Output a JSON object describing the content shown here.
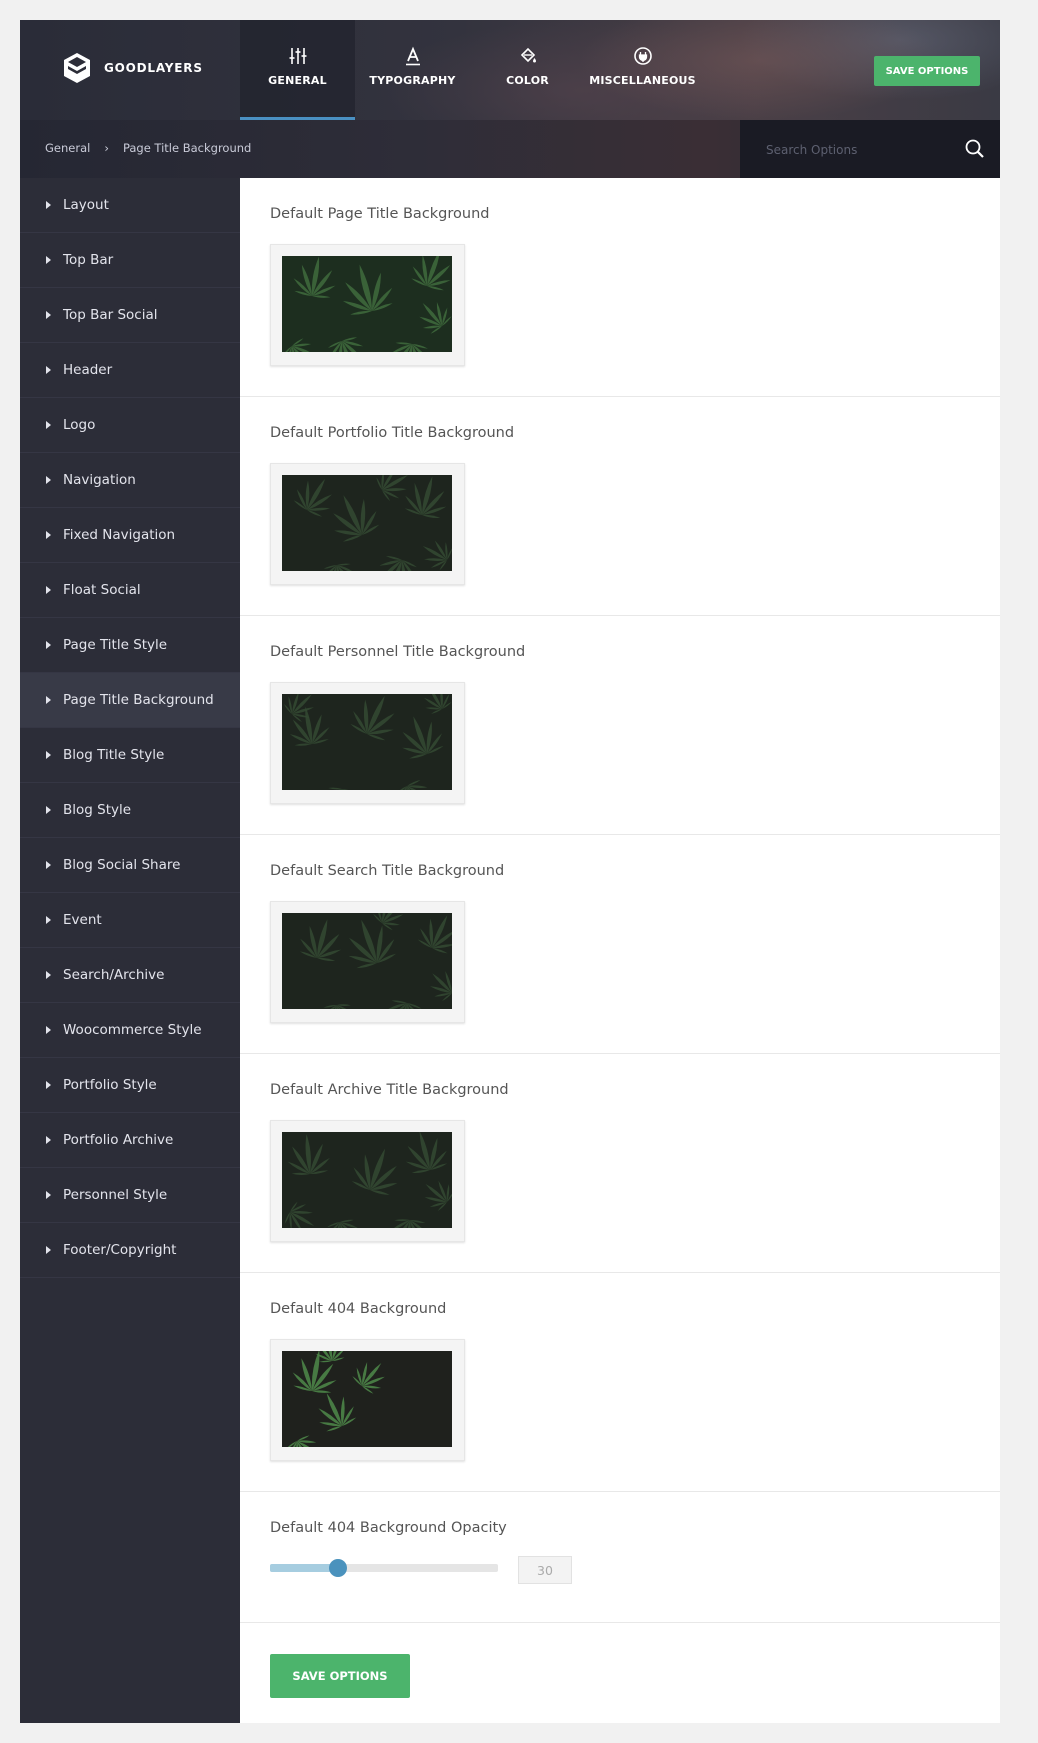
{
  "brand": {
    "name": "GOODLAYERS"
  },
  "tabs": [
    {
      "label": "GENERAL",
      "icon": "sliders-icon",
      "active": true
    },
    {
      "label": "TYPOGRAPHY",
      "icon": "letter-a-icon"
    },
    {
      "label": "COLOR",
      "icon": "paint-bucket-icon"
    },
    {
      "label": "MISCELLANEOUS",
      "icon": "plug-icon"
    }
  ],
  "save_label": "SAVE OPTIONS",
  "breadcrumb": {
    "root": "General",
    "separator": "›",
    "current": "Page Title Background"
  },
  "search": {
    "placeholder": "Search Options"
  },
  "sidebar": {
    "items": [
      {
        "label": "Layout"
      },
      {
        "label": "Top Bar"
      },
      {
        "label": "Top Bar Social"
      },
      {
        "label": "Header"
      },
      {
        "label": "Logo"
      },
      {
        "label": "Navigation"
      },
      {
        "label": "Fixed Navigation"
      },
      {
        "label": "Float Social"
      },
      {
        "label": "Page Title Style"
      },
      {
        "label": "Page Title Background",
        "active": true
      },
      {
        "label": "Blog Title Style"
      },
      {
        "label": "Blog Style"
      },
      {
        "label": "Blog Social Share"
      },
      {
        "label": "Event"
      },
      {
        "label": "Search/Archive"
      },
      {
        "label": "Woocommerce Style"
      },
      {
        "label": "Portfolio Style"
      },
      {
        "label": "Portfolio Archive"
      },
      {
        "label": "Personnel Style"
      },
      {
        "label": "Footer/Copyright"
      }
    ]
  },
  "sections": [
    {
      "title": "Default Page Title Background"
    },
    {
      "title": "Default Portfolio Title Background"
    },
    {
      "title": "Default Personnel Title Background"
    },
    {
      "title": "Default Search Title Background"
    },
    {
      "title": "Default Archive Title Background"
    },
    {
      "title": "Default 404 Background"
    }
  ],
  "opacity": {
    "title": "Default 404 Background Opacity",
    "value": "30",
    "max": 100
  },
  "colors": {
    "accent_green": "#4cb46c",
    "tab_active_underline": "#4a90c2",
    "sidebar_bg": "#2c2d38"
  }
}
